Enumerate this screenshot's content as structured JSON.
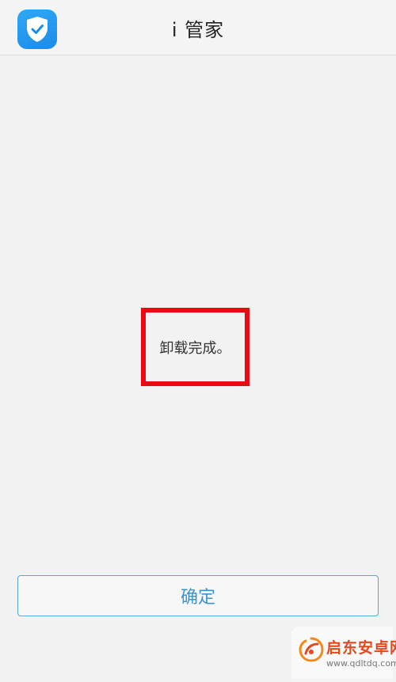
{
  "header": {
    "title": "i 管家",
    "icon": "shield-check-icon",
    "icon_color": "#1c8be8"
  },
  "dialog": {
    "message": "卸载完成。",
    "highlight_color": "#ec0a12"
  },
  "footer": {
    "confirm_label": "确定",
    "confirm_color": "#3d93cc"
  },
  "watermark": {
    "name": "启东安卓网",
    "url": "www.qdltdq.com",
    "icon": "watermark-logo-icon"
  }
}
